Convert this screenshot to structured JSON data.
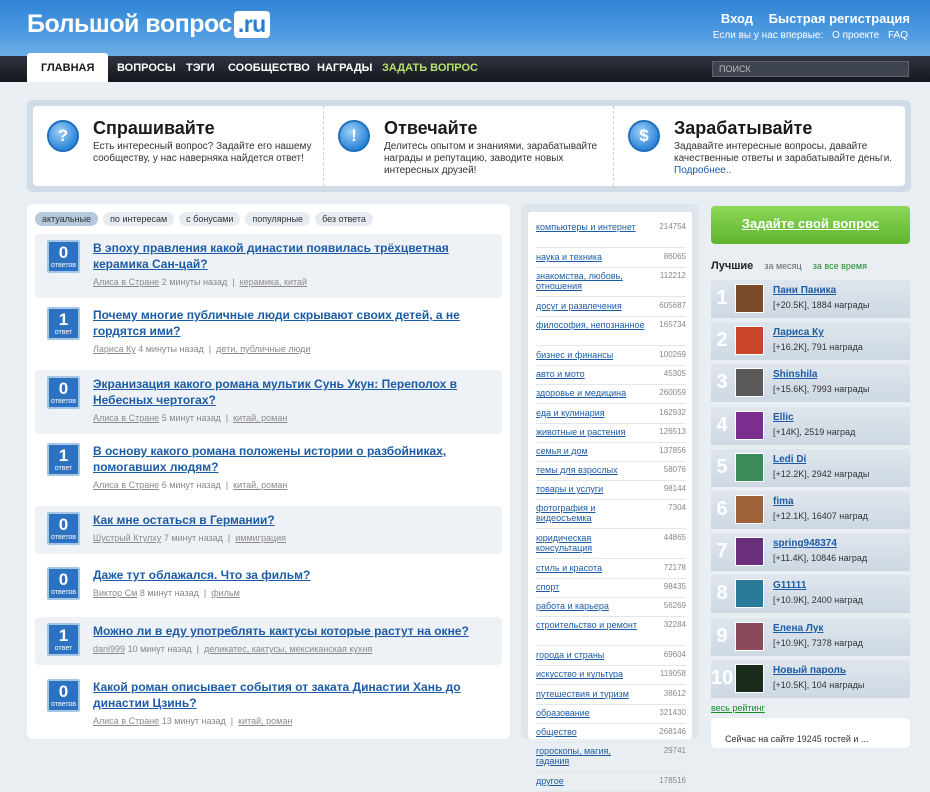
{
  "header": {
    "logo_main": "Большой вопрос",
    "logo_suffix": ".ru",
    "login": "Вход",
    "register": "Быстрая регистрация",
    "first_time_text": "Если вы у нас впервые:",
    "about_link": "О проекте",
    "faq_link": "FAQ"
  },
  "nav": {
    "items": [
      "ГЛАВНАЯ",
      "ВОПРОСЫ",
      "ТЭГИ",
      "СООБЩЕСТВО",
      "НАГРАДЫ",
      "ЗАДАТЬ ВОПРОС"
    ],
    "search_placeholder": "ПОИСК"
  },
  "intro": [
    {
      "icon": "question-icon",
      "glyph": "?",
      "title": "Спрашивайте",
      "text": "Есть интересный вопрос? Задайте его нашему сообществу, у нас наверняка найдется ответ!"
    },
    {
      "icon": "exclamation-icon",
      "glyph": "!",
      "title": "Отвечайте",
      "text": "Делитесь опытом и знаниями, зарабатывайте награды и репутацию, заводите новых интересных друзей!"
    },
    {
      "icon": "dollar-icon",
      "glyph": "$",
      "title": "Зарабатывайте",
      "text": "Задавайте интересные вопросы, давайте качественные ответы и зарабатывайте деньги.",
      "more": "Подробнее.."
    }
  ],
  "filters": [
    "актуальные",
    "по интересам",
    "с бонусами",
    "популярные",
    "без ответа"
  ],
  "questions": [
    {
      "count": "0",
      "label": "ответов",
      "title": "В эпоху правления какой династии появилась трёхцветная керамика Сан-цай?",
      "author": "Алиса в Стране",
      "time": "2 минуты назад",
      "tags": "керамика, китай"
    },
    {
      "count": "1",
      "label": "ответ",
      "title": "Почему многие публичные люди скрывают своих детей, а не гордятся ими?",
      "author": "Лариса Ку",
      "time": "4 минуты назад",
      "tags": "дети, публичные люди"
    },
    {
      "count": "0",
      "label": "ответов",
      "title": "Экранизация какого романа мультик Сунь Укун: Переполох в Небесных чертогах?",
      "author": "Алиса в Стране",
      "time": "5 минут назад",
      "tags": "китай, роман"
    },
    {
      "count": "1",
      "label": "ответ",
      "title": "В основу какого романа положены истории о разбойниках, помогавших людям?",
      "author": "Алиса в Стране",
      "time": "6 минут назад",
      "tags": "китай, роман"
    },
    {
      "count": "0",
      "label": "ответов",
      "title": "Как мне остаться в Германии?",
      "author": "Шустрый Ктулху",
      "time": "7 минут назад",
      "tags": "иммиграция"
    },
    {
      "count": "0",
      "label": "ответов",
      "title": "Даже тут облажался. Что за фильм?",
      "author": "Виктор См",
      "time": "8 минут назад",
      "tags": "фильм"
    },
    {
      "count": "1",
      "label": "ответ",
      "title": "Можно ли в еду употреблять кактусы которые растут на окне?",
      "author": "dani999",
      "time": "10 минут назад",
      "tags": "деликатес, кактусы, мексиканская кухня"
    },
    {
      "count": "0",
      "label": "ответов",
      "title": "Какой роман описывает события от заката Династии Хань до династии Цзинь?",
      "author": "Алиса в Стране",
      "time": "13 минут назад",
      "tags": "китай, роман"
    }
  ],
  "categories": [
    {
      "name": "компьютеры и интернет",
      "count": "214754"
    },
    {
      "name": "наука и техника",
      "count": "86065"
    },
    {
      "name": "знакомства, любовь, отношения",
      "count": "112212"
    },
    {
      "name": "досуг и развлечения",
      "count": "605687"
    },
    {
      "name": "философия, непознанное",
      "count": "165734"
    },
    {
      "name": "бизнес и финансы",
      "count": "100269"
    },
    {
      "name": "авто и мото",
      "count": "45305"
    },
    {
      "name": "здоровье и медицина",
      "count": "260059"
    },
    {
      "name": "еда и кулинария",
      "count": "162932"
    },
    {
      "name": "животные и растения",
      "count": "126513"
    },
    {
      "name": "семья и дом",
      "count": "137856"
    },
    {
      "name": "темы для взрослых",
      "count": "58076"
    },
    {
      "name": "товары и услуги",
      "count": "98144"
    },
    {
      "name": "фотография и видеосъемка",
      "count": "7304"
    },
    {
      "name": "юридическая консультация",
      "count": "44865"
    },
    {
      "name": "стиль и красота",
      "count": "72178"
    },
    {
      "name": "спорт",
      "count": "98435"
    },
    {
      "name": "работа и карьера",
      "count": "56269"
    },
    {
      "name": "строительство и ремонт",
      "count": "32284"
    },
    {
      "name": "города и страны",
      "count": "69604"
    },
    {
      "name": "искусство и культура",
      "count": "119058"
    },
    {
      "name": "путешествия и туризм",
      "count": "38612"
    },
    {
      "name": "образование",
      "count": "321430"
    },
    {
      "name": "общество",
      "count": "268146"
    },
    {
      "name": "гороскопы, магия, гадания",
      "count": "29741"
    },
    {
      "name": "другое",
      "count": "178516"
    }
  ],
  "right": {
    "ask_button": "Задайте свой вопрос",
    "best_title": "Лучшие",
    "best_month": "за месяц",
    "best_all": "за все время",
    "all_rating": "весь рейтинг",
    "stats_text": "Сейчас на сайте 19245 гостей и ..."
  },
  "users": [
    {
      "rank": "1",
      "name": "Пани Паника",
      "stats": "[+20.5K], 1884 награды",
      "color": "#7a4a2a"
    },
    {
      "rank": "2",
      "name": "Лариса Ку",
      "stats": "[+16.2K], 791 награда",
      "color": "#c8452a"
    },
    {
      "rank": "3",
      "name": "Shinshila",
      "stats": "[+15.6K], 7993 награды",
      "color": "#5a5a5a"
    },
    {
      "rank": "4",
      "name": "Ellic",
      "stats": "[+14K], 2519 наград",
      "color": "#7a2f8f"
    },
    {
      "rank": "5",
      "name": "Ledi Di",
      "stats": "[+12.2K], 2942 награды",
      "color": "#3a8a5a"
    },
    {
      "rank": "6",
      "name": "fima",
      "stats": "[+12.1K], 16407 наград",
      "color": "#a0623a"
    },
    {
      "rank": "7",
      "name": "spring948374",
      "stats": "[+11.4K], 10846 наград",
      "color": "#6a2f7a"
    },
    {
      "rank": "8",
      "name": "G11111",
      "stats": "[+10.9K], 2400 наград",
      "color": "#2a7a9a"
    },
    {
      "rank": "9",
      "name": "Елена Лук",
      "stats": "[+10.9K], 7378 наград",
      "color": "#8a4a5a"
    },
    {
      "rank": "10",
      "name": "Новый пароль",
      "stats": "[+10.5K], 104 награды",
      "color": "#1a2a1a"
    }
  ]
}
